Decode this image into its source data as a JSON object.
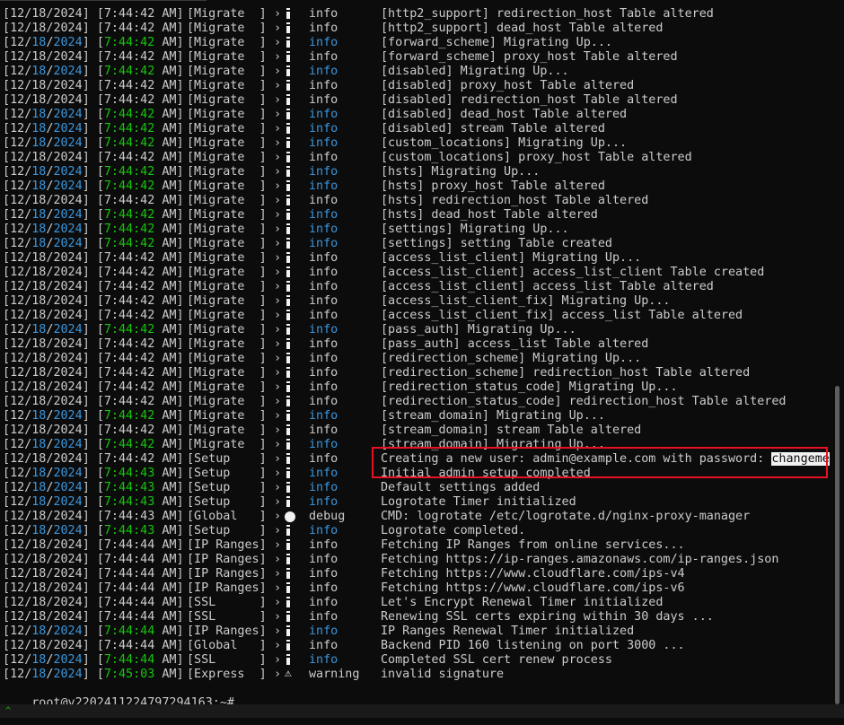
{
  "window": {
    "status_glyph": "^"
  },
  "terminal": {
    "rows": [
      {
        "d": "12",
        "m": "18",
        "y": "2024",
        "t": "7:44:42",
        "ap": "AM",
        "scope": "[Migrate  ]",
        "lvl": "info",
        "icon": "info",
        "msg": "[http2_support] redirection_host Table altered",
        "hl": false
      },
      {
        "d": "12",
        "m": "18",
        "y": "2024",
        "t": "7:44:42",
        "ap": "AM",
        "scope": "[Migrate  ]",
        "lvl": "info",
        "icon": "info",
        "msg": "[http2_support] dead_host Table altered",
        "hl": false
      },
      {
        "d": "12",
        "m": "18",
        "y": "2024",
        "t": "7:44:42",
        "ap": "AM",
        "scope": "[Migrate  ]",
        "lvl": "info",
        "icon": "info",
        "msg": "[forward_scheme] Migrating Up...",
        "hl": true
      },
      {
        "d": "12",
        "m": "18",
        "y": "2024",
        "t": "7:44:42",
        "ap": "AM",
        "scope": "[Migrate  ]",
        "lvl": "info",
        "icon": "info",
        "msg": "[forward_scheme] proxy_host Table altered",
        "hl": false
      },
      {
        "d": "12",
        "m": "18",
        "y": "2024",
        "t": "7:44:42",
        "ap": "AM",
        "scope": "[Migrate  ]",
        "lvl": "info",
        "icon": "info",
        "msg": "[disabled] Migrating Up...",
        "hl": true
      },
      {
        "d": "12",
        "m": "18",
        "y": "2024",
        "t": "7:44:42",
        "ap": "AM",
        "scope": "[Migrate  ]",
        "lvl": "info",
        "icon": "info",
        "msg": "[disabled] proxy_host Table altered",
        "hl": false
      },
      {
        "d": "12",
        "m": "18",
        "y": "2024",
        "t": "7:44:42",
        "ap": "AM",
        "scope": "[Migrate  ]",
        "lvl": "info",
        "icon": "info",
        "msg": "[disabled] redirection_host Table altered",
        "hl": false
      },
      {
        "d": "12",
        "m": "18",
        "y": "2024",
        "t": "7:44:42",
        "ap": "AM",
        "scope": "[Migrate  ]",
        "lvl": "info",
        "icon": "info",
        "msg": "[disabled] dead_host Table altered",
        "hl": true
      },
      {
        "d": "12",
        "m": "18",
        "y": "2024",
        "t": "7:44:42",
        "ap": "AM",
        "scope": "[Migrate  ]",
        "lvl": "info",
        "icon": "info",
        "msg": "[disabled] stream Table altered",
        "hl": true
      },
      {
        "d": "12",
        "m": "18",
        "y": "2024",
        "t": "7:44:42",
        "ap": "AM",
        "scope": "[Migrate  ]",
        "lvl": "info",
        "icon": "info",
        "msg": "[custom_locations] Migrating Up...",
        "hl": true
      },
      {
        "d": "12",
        "m": "18",
        "y": "2024",
        "t": "7:44:42",
        "ap": "AM",
        "scope": "[Migrate  ]",
        "lvl": "info",
        "icon": "info",
        "msg": "[custom_locations] proxy_host Table altered",
        "hl": false
      },
      {
        "d": "12",
        "m": "18",
        "y": "2024",
        "t": "7:44:42",
        "ap": "AM",
        "scope": "[Migrate  ]",
        "lvl": "info",
        "icon": "info",
        "msg": "[hsts] Migrating Up...",
        "hl": true
      },
      {
        "d": "12",
        "m": "18",
        "y": "2024",
        "t": "7:44:42",
        "ap": "AM",
        "scope": "[Migrate  ]",
        "lvl": "info",
        "icon": "info",
        "msg": "[hsts] proxy_host Table altered",
        "hl": true
      },
      {
        "d": "12",
        "m": "18",
        "y": "2024",
        "t": "7:44:42",
        "ap": "AM",
        "scope": "[Migrate  ]",
        "lvl": "info",
        "icon": "info",
        "msg": "[hsts] redirection_host Table altered",
        "hl": false
      },
      {
        "d": "12",
        "m": "18",
        "y": "2024",
        "t": "7:44:42",
        "ap": "AM",
        "scope": "[Migrate  ]",
        "lvl": "info",
        "icon": "info",
        "msg": "[hsts] dead_host Table altered",
        "hl": true
      },
      {
        "d": "12",
        "m": "18",
        "y": "2024",
        "t": "7:44:42",
        "ap": "AM",
        "scope": "[Migrate  ]",
        "lvl": "info",
        "icon": "info",
        "msg": "[settings] Migrating Up...",
        "hl": true
      },
      {
        "d": "12",
        "m": "18",
        "y": "2024",
        "t": "7:44:42",
        "ap": "AM",
        "scope": "[Migrate  ]",
        "lvl": "info",
        "icon": "info",
        "msg": "[settings] setting Table created",
        "hl": true
      },
      {
        "d": "12",
        "m": "18",
        "y": "2024",
        "t": "7:44:42",
        "ap": "AM",
        "scope": "[Migrate  ]",
        "lvl": "info",
        "icon": "info",
        "msg": "[access_list_client] Migrating Up...",
        "hl": false
      },
      {
        "d": "12",
        "m": "18",
        "y": "2024",
        "t": "7:44:42",
        "ap": "AM",
        "scope": "[Migrate  ]",
        "lvl": "info",
        "icon": "info",
        "msg": "[access_list_client] access_list_client Table created",
        "hl": false
      },
      {
        "d": "12",
        "m": "18",
        "y": "2024",
        "t": "7:44:42",
        "ap": "AM",
        "scope": "[Migrate  ]",
        "lvl": "info",
        "icon": "info",
        "msg": "[access_list_client] access_list Table altered",
        "hl": false
      },
      {
        "d": "12",
        "m": "18",
        "y": "2024",
        "t": "7:44:42",
        "ap": "AM",
        "scope": "[Migrate  ]",
        "lvl": "info",
        "icon": "info",
        "msg": "[access_list_client_fix] Migrating Up...",
        "hl": false
      },
      {
        "d": "12",
        "m": "18",
        "y": "2024",
        "t": "7:44:42",
        "ap": "AM",
        "scope": "[Migrate  ]",
        "lvl": "info",
        "icon": "info",
        "msg": "[access_list_client_fix] access_list Table altered",
        "hl": false
      },
      {
        "d": "12",
        "m": "18",
        "y": "2024",
        "t": "7:44:42",
        "ap": "AM",
        "scope": "[Migrate  ]",
        "lvl": "info",
        "icon": "info",
        "msg": "[pass_auth] Migrating Up...",
        "hl": true
      },
      {
        "d": "12",
        "m": "18",
        "y": "2024",
        "t": "7:44:42",
        "ap": "AM",
        "scope": "[Migrate  ]",
        "lvl": "info",
        "icon": "info",
        "msg": "[pass_auth] access_list Table altered",
        "hl": false
      },
      {
        "d": "12",
        "m": "18",
        "y": "2024",
        "t": "7:44:42",
        "ap": "AM",
        "scope": "[Migrate  ]",
        "lvl": "info",
        "icon": "info",
        "msg": "[redirection_scheme] Migrating Up...",
        "hl": false
      },
      {
        "d": "12",
        "m": "18",
        "y": "2024",
        "t": "7:44:42",
        "ap": "AM",
        "scope": "[Migrate  ]",
        "lvl": "info",
        "icon": "info",
        "msg": "[redirection_scheme] redirection_host Table altered",
        "hl": false
      },
      {
        "d": "12",
        "m": "18",
        "y": "2024",
        "t": "7:44:42",
        "ap": "AM",
        "scope": "[Migrate  ]",
        "lvl": "info",
        "icon": "info",
        "msg": "[redirection_status_code] Migrating Up...",
        "hl": false
      },
      {
        "d": "12",
        "m": "18",
        "y": "2024",
        "t": "7:44:42",
        "ap": "AM",
        "scope": "[Migrate  ]",
        "lvl": "info",
        "icon": "info",
        "msg": "[redirection_status_code] redirection_host Table altered",
        "hl": false
      },
      {
        "d": "12",
        "m": "18",
        "y": "2024",
        "t": "7:44:42",
        "ap": "AM",
        "scope": "[Migrate  ]",
        "lvl": "info",
        "icon": "info",
        "msg": "[stream_domain] Migrating Up...",
        "hl": true
      },
      {
        "d": "12",
        "m": "18",
        "y": "2024",
        "t": "7:44:42",
        "ap": "AM",
        "scope": "[Migrate  ]",
        "lvl": "info",
        "icon": "info",
        "msg": "[stream_domain] stream Table altered",
        "hl": false
      },
      {
        "d": "12",
        "m": "18",
        "y": "2024",
        "t": "7:44:42",
        "ap": "AM",
        "scope": "[Migrate  ]",
        "lvl": "info",
        "icon": "info",
        "msg": "[stream_domain] Migrating Up...",
        "hl": true
      },
      {
        "d": "12",
        "m": "18",
        "y": "2024",
        "t": "7:44:42",
        "ap": "AM",
        "scope": "[Setup    ]",
        "lvl": "info",
        "icon": "info",
        "msg": "Creating a new user: admin@example.com with password: ",
        "sel": "changeme",
        "hl": false
      },
      {
        "d": "12",
        "m": "18",
        "y": "2024",
        "t": "7:44:43",
        "ap": "AM",
        "scope": "[Setup    ]",
        "lvl": "info",
        "icon": "info",
        "msg": "Initial admin setup completed",
        "hl": true
      },
      {
        "d": "12",
        "m": "18",
        "y": "2024",
        "t": "7:44:43",
        "ap": "AM",
        "scope": "[Setup    ]",
        "lvl": "info",
        "icon": "info",
        "msg": "Default settings added",
        "hl": true
      },
      {
        "d": "12",
        "m": "18",
        "y": "2024",
        "t": "7:44:43",
        "ap": "AM",
        "scope": "[Setup    ]",
        "lvl": "info",
        "icon": "info",
        "msg": "Logrotate Timer initialized",
        "hl": true
      },
      {
        "d": "12",
        "m": "18",
        "y": "2024",
        "t": "7:44:43",
        "ap": "AM",
        "scope": "[Global   ]",
        "lvl": "debug",
        "icon": "debug",
        "msg": "CMD: logrotate /etc/logrotate.d/nginx-proxy-manager",
        "hl": false
      },
      {
        "d": "12",
        "m": "18",
        "y": "2024",
        "t": "7:44:43",
        "ap": "AM",
        "scope": "[Setup    ]",
        "lvl": "info",
        "icon": "info",
        "msg": "Logrotate completed.",
        "hl": true
      },
      {
        "d": "12",
        "m": "18",
        "y": "2024",
        "t": "7:44:44",
        "ap": "AM",
        "scope": "[IP Ranges]",
        "lvl": "info",
        "icon": "info",
        "msg": "Fetching IP Ranges from online services...",
        "hl": false
      },
      {
        "d": "12",
        "m": "18",
        "y": "2024",
        "t": "7:44:44",
        "ap": "AM",
        "scope": "[IP Ranges]",
        "lvl": "info",
        "icon": "info",
        "msg": "Fetching https://ip-ranges.amazonaws.com/ip-ranges.json",
        "hl": false
      },
      {
        "d": "12",
        "m": "18",
        "y": "2024",
        "t": "7:44:44",
        "ap": "AM",
        "scope": "[IP Ranges]",
        "lvl": "info",
        "icon": "info",
        "msg": "Fetching https://www.cloudflare.com/ips-v4",
        "hl": false
      },
      {
        "d": "12",
        "m": "18",
        "y": "2024",
        "t": "7:44:44",
        "ap": "AM",
        "scope": "[IP Ranges]",
        "lvl": "info",
        "icon": "info",
        "msg": "Fetching https://www.cloudflare.com/ips-v6",
        "hl": false
      },
      {
        "d": "12",
        "m": "18",
        "y": "2024",
        "t": "7:44:44",
        "ap": "AM",
        "scope": "[SSL      ]",
        "lvl": "info",
        "icon": "info",
        "msg": "Let's Encrypt Renewal Timer initialized",
        "hl": false
      },
      {
        "d": "12",
        "m": "18",
        "y": "2024",
        "t": "7:44:44",
        "ap": "AM",
        "scope": "[SSL      ]",
        "lvl": "info",
        "icon": "info",
        "msg": "Renewing SSL certs expiring within 30 days ...",
        "hl": false
      },
      {
        "d": "12",
        "m": "18",
        "y": "2024",
        "t": "7:44:44",
        "ap": "AM",
        "scope": "[IP Ranges]",
        "lvl": "info",
        "icon": "info",
        "msg": "IP Ranges Renewal Timer initialized",
        "hl": true
      },
      {
        "d": "12",
        "m": "18",
        "y": "2024",
        "t": "7:44:44",
        "ap": "AM",
        "scope": "[Global   ]",
        "lvl": "info",
        "icon": "info",
        "msg": "Backend PID 160 listening on port 3000 ...",
        "hl": false
      },
      {
        "d": "12",
        "m": "18",
        "y": "2024",
        "t": "7:44:44",
        "ap": "AM",
        "scope": "[SSL      ]",
        "lvl": "info",
        "icon": "info",
        "msg": "Completed SSL cert renew process",
        "hl": true
      },
      {
        "d": "12",
        "m": "18",
        "y": "2024",
        "t": "7:45:03",
        "ap": "AM",
        "scope": "[Express  ]",
        "lvl": "warning",
        "icon": "warning",
        "msg": "invalid signature",
        "hl": true
      }
    ],
    "prompt": "root@v2202411224797294163:~#"
  },
  "colors": {
    "background": "#0c0c0c",
    "text": "#cccccc",
    "blue": "#3a96dd",
    "green": "#16c60c",
    "highlight_box": "#e81123"
  }
}
